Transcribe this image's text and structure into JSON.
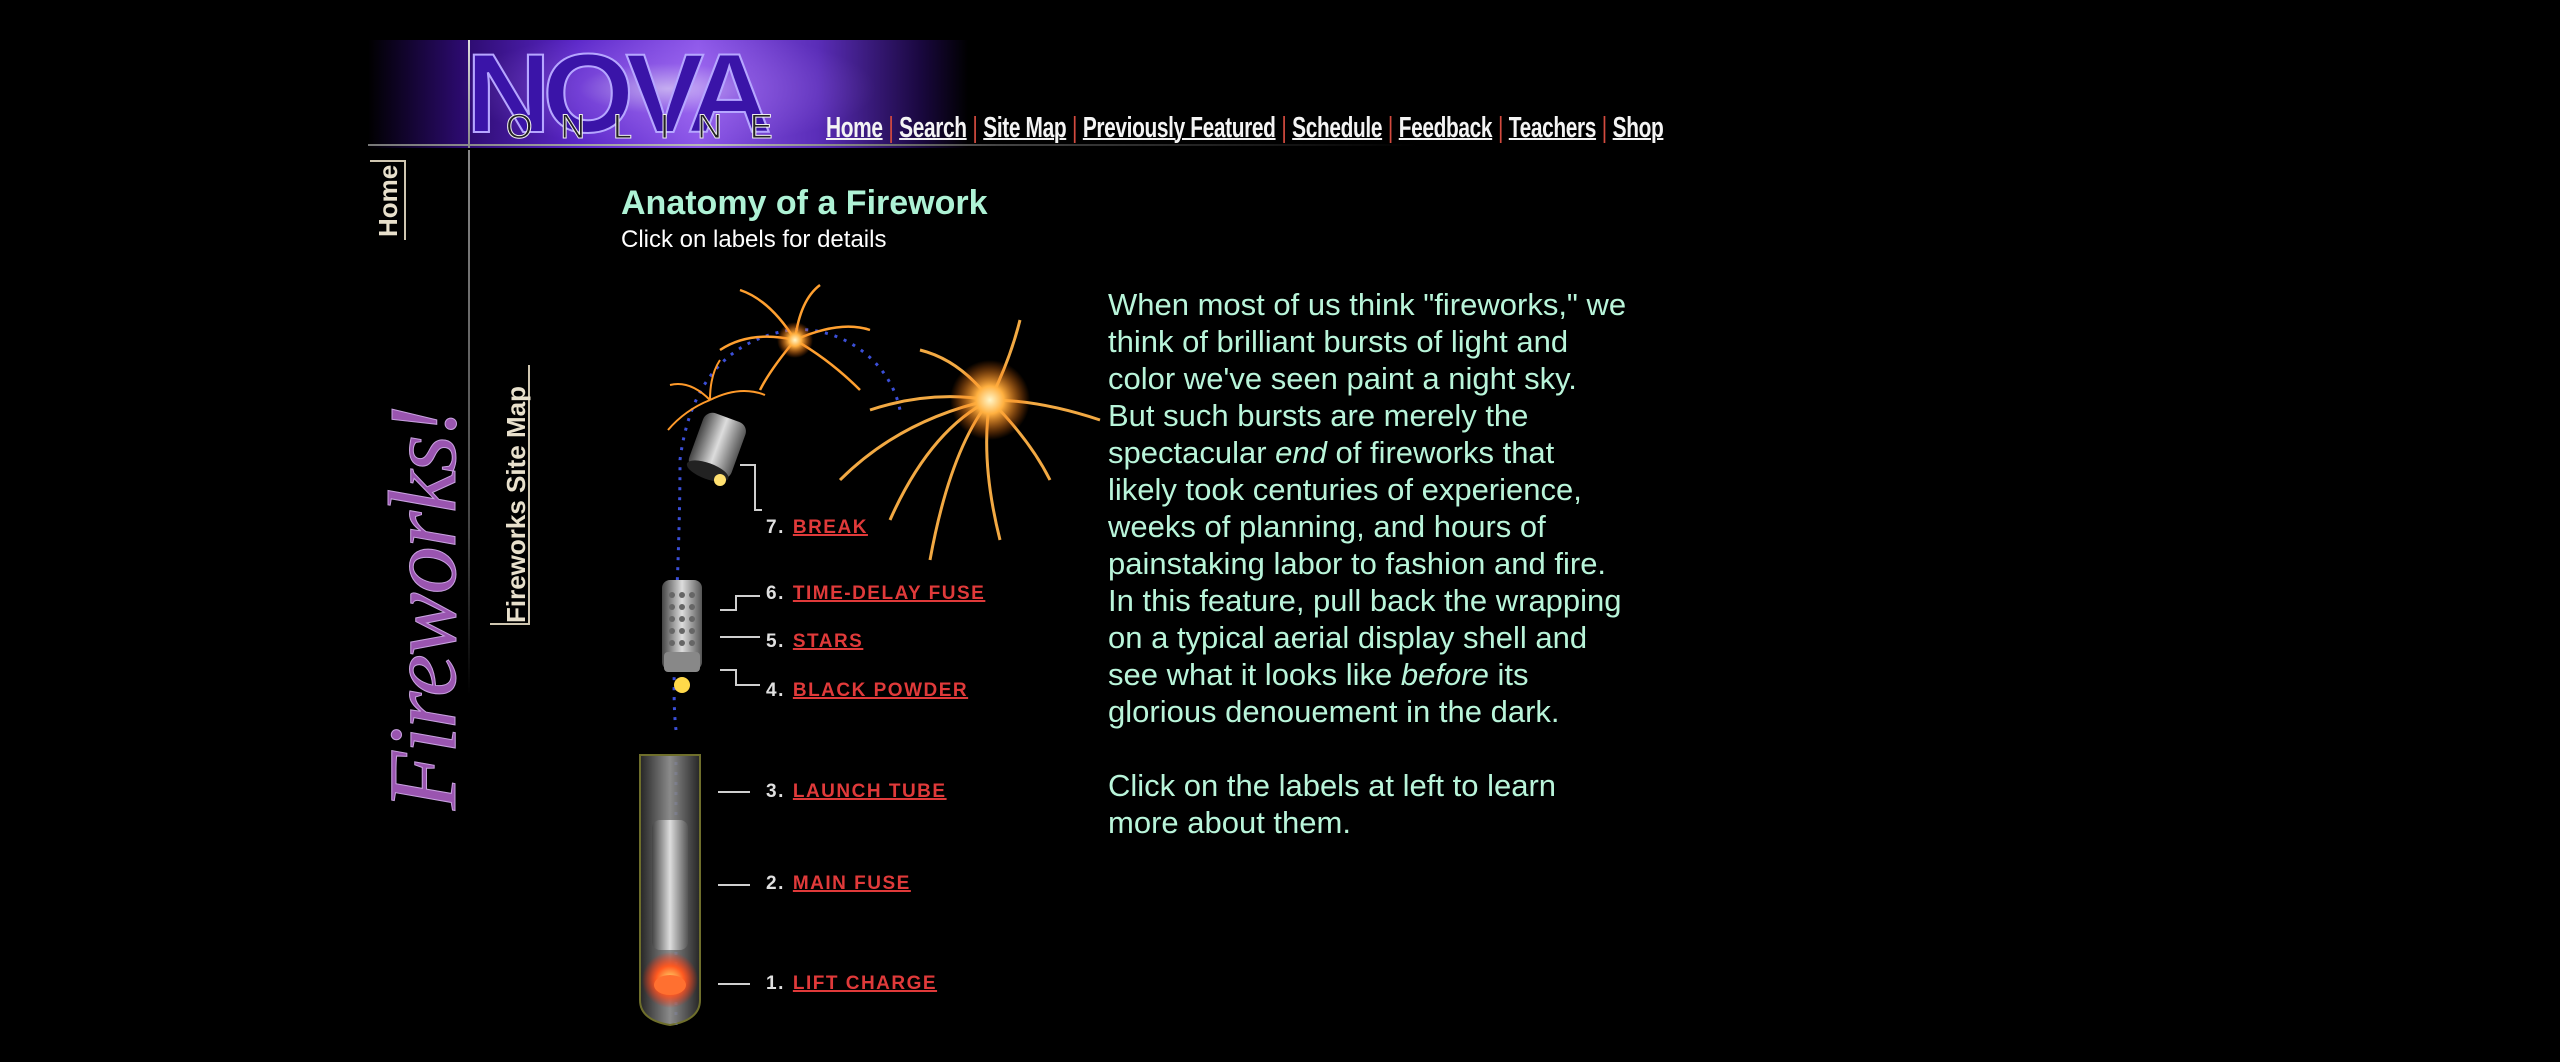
{
  "header": {
    "logo_text": "NOVA",
    "logo_subtext": "ONLINE",
    "nav": [
      {
        "label": "Home"
      },
      {
        "label": "Search"
      },
      {
        "label": "Site Map"
      },
      {
        "label": "Previously Featured"
      },
      {
        "label": "Schedule"
      },
      {
        "label": "Feedback"
      },
      {
        "label": "Teachers"
      },
      {
        "label": "Shop"
      }
    ],
    "separator": "|"
  },
  "sidebar": {
    "home_label": "Home",
    "section_title": "Fireworks!",
    "site_map_label": "Fireworks Site Map"
  },
  "main": {
    "title": "Anatomy of a Firework",
    "subtitle": "Click on labels for details"
  },
  "diagram": {
    "labels": [
      {
        "number": "7.",
        "label": "BREAK"
      },
      {
        "number": "6.",
        "label": "TIME-DELAY FUSE"
      },
      {
        "number": "5.",
        "label": "STARS"
      },
      {
        "number": "4.",
        "label": "BLACK POWDER"
      },
      {
        "number": "3.",
        "label": "LAUNCH TUBE"
      },
      {
        "number": "2.",
        "label": "MAIN FUSE"
      },
      {
        "number": "1.",
        "label": "LIFT CHARGE"
      }
    ]
  },
  "body": {
    "p1_a": "When most of us think \"fireworks,\" we think of brilliant bursts of light and color we've seen paint a night sky. But such bursts are merely the spectacular ",
    "p1_em1": "end",
    "p1_b": " of fireworks that likely took centuries of experience, weeks of planning, and hours of painstaking labor to fashion and fire. In this feature, pull back the wrapping on a typical aerial display shell and see what it looks like ",
    "p1_em2": "before",
    "p1_c": " its glorious denouement in the dark.",
    "p2": "Click on the labels at left to learn more about them."
  },
  "colors": {
    "background": "#000000",
    "title": "#aef2d5",
    "body_text": "#b9f5da",
    "label_red": "#e03a3a",
    "nav_separator": "#d44b3f",
    "sidebar_purple": "#9a55b0"
  }
}
